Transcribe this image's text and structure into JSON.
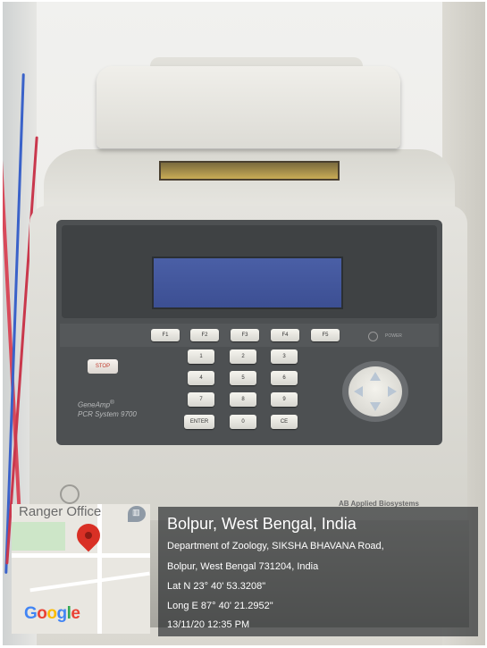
{
  "device": {
    "function_keys": [
      "F1",
      "F2",
      "F3",
      "F4",
      "F5"
    ],
    "power_label": "POWER",
    "stop_label": "STOP",
    "keypad": [
      "1",
      "2",
      "3",
      "4",
      "5",
      "6",
      "7",
      "8",
      "9",
      "ENTER",
      "0",
      "CE"
    ],
    "brand_line1": "GeneAmp",
    "brand_mark": "®",
    "brand_line2": "PCR System 9700",
    "maker_logo": "AB Applied Biosystems"
  },
  "map": {
    "place_label": "Ranger Office",
    "marker_icon": "map-pin-icon",
    "poi_icon": "bank-icon",
    "logo": "Google"
  },
  "location": {
    "title": "Bolpur, West Bengal, India",
    "address_line1": "Department of Zoology, SIKSHA BHAVANA Road,",
    "address_line2": "Bolpur, West Bengal 731204, India",
    "latitude": "Lat N 23° 40' 53.3208\"",
    "longitude": "Long E 87° 40' 21.2952\"",
    "datetime": "13/11/20 12:35 PM"
  },
  "colors": {
    "lcd": "#3f5296",
    "pin": "#d93025",
    "overlay": "#1c1f21"
  }
}
